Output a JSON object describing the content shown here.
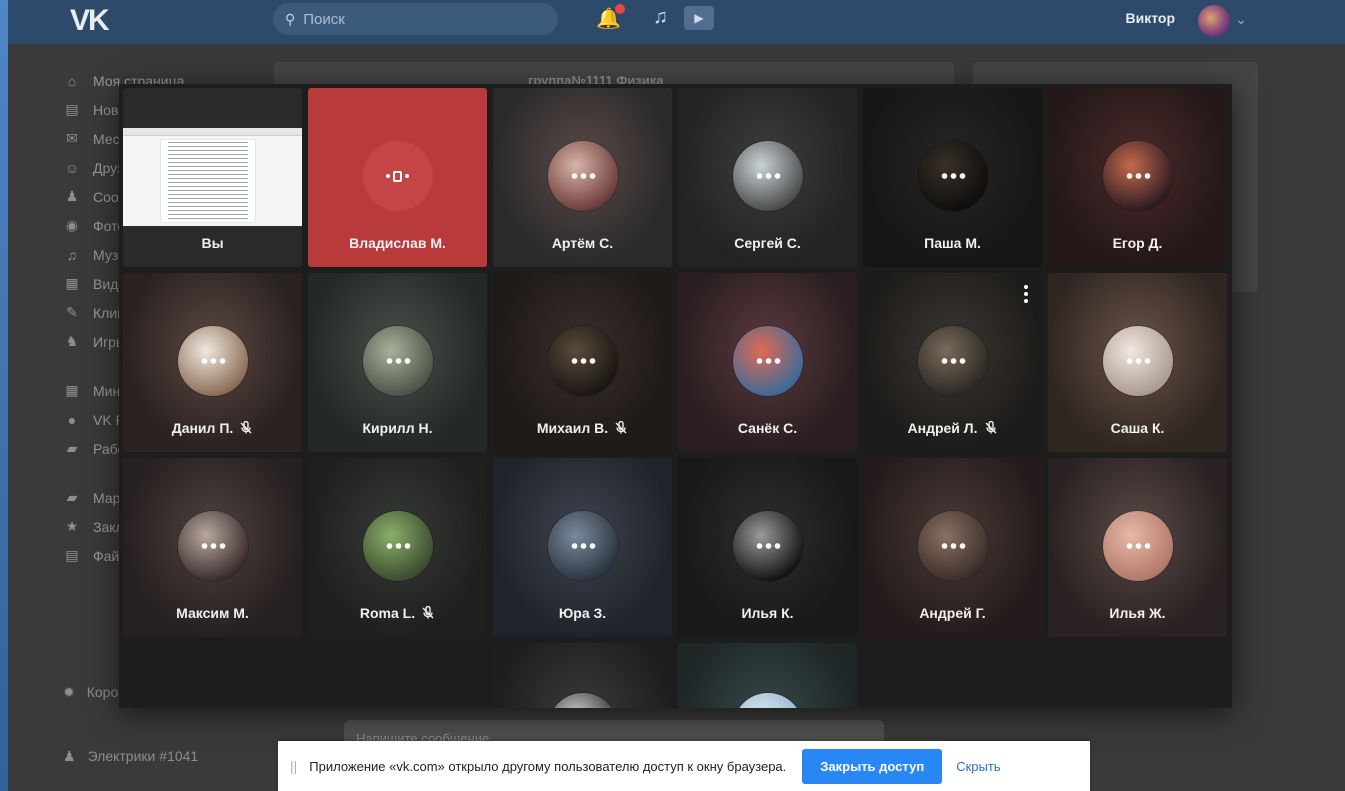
{
  "header": {
    "logo": "VK",
    "search_placeholder": "Поиск",
    "user_name": "Виктор"
  },
  "sidebar": {
    "items": [
      {
        "label": "Моя страница",
        "icon": "home-icon"
      },
      {
        "label": "Новости",
        "icon": "news-icon"
      },
      {
        "label": "Мессенджер",
        "icon": "messages-icon"
      },
      {
        "label": "Друзья",
        "icon": "friend-icon"
      },
      {
        "label": "Сообщества",
        "icon": "groups-icon"
      },
      {
        "label": "Фотографии",
        "icon": "camera-icon"
      },
      {
        "label": "Музыка",
        "icon": "music-icon"
      },
      {
        "label": "Видео",
        "icon": "video-icon"
      },
      {
        "label": "Клипы",
        "icon": "clips-icon"
      },
      {
        "label": "Игры",
        "icon": "games-icon"
      }
    ],
    "items2": [
      {
        "label": "Мини-приложения",
        "icon": "apps-icon"
      },
      {
        "label": "VK Pay",
        "icon": "pay-icon"
      },
      {
        "label": "Работа",
        "icon": "work-icon"
      }
    ],
    "items3": [
      {
        "label": "Маркет",
        "icon": "market-icon"
      },
      {
        "label": "Закладки",
        "icon": "star-icon"
      },
      {
        "label": "Файлы",
        "icon": "file-icon"
      }
    ],
    "coronavirus": "Коронавирус",
    "group_link": "Электрики #1041"
  },
  "chat": {
    "title": "группа№1111 Физика",
    "input_placeholder": "Напишите сообщение..."
  },
  "call": {
    "participants": [
      {
        "name": "Вы",
        "type": "you",
        "muted": false
      },
      {
        "name": "Владислав М.",
        "type": "red",
        "muted": false
      },
      {
        "name": "Артём С.",
        "muted": false,
        "bg": [
          "#5a4a48",
          "#2a2a2a"
        ],
        "av": [
          "#d8b4a8",
          "#6a3a38"
        ]
      },
      {
        "name": "Сергей С.",
        "muted": false,
        "bg": [
          "#3d3d3b",
          "#232323"
        ],
        "av": [
          "#c9d3d9",
          "#4a4a48"
        ]
      },
      {
        "name": "Паша М.",
        "muted": false,
        "bg": [
          "#262626",
          "#161616"
        ],
        "av": [
          "#3a3026",
          "#0e0e0e"
        ]
      },
      {
        "name": "Егор Д.",
        "muted": false,
        "bg": [
          "#4a2a2a",
          "#241818"
        ],
        "av": [
          "#c46a4a",
          "#2a1a22"
        ]
      },
      {
        "name": "Данил П.",
        "muted": true,
        "bg": [
          "#5a4842",
          "#2a2220"
        ],
        "av": [
          "#f0e8e0",
          "#8a6a54"
        ]
      },
      {
        "name": "Кирилл Н.",
        "muted": false,
        "bg": [
          "#48504a",
          "#242826"
        ],
        "av": [
          "#a8b098",
          "#4a5448"
        ]
      },
      {
        "name": "Михаил В.",
        "muted": true,
        "bg": [
          "#3a2e2a",
          "#1e1a18"
        ],
        "av": [
          "#5a4a3a",
          "#1a1614"
        ]
      },
      {
        "name": "Санёк С.",
        "muted": false,
        "bg": [
          "#5a3a3e",
          "#2a1e20"
        ],
        "av": [
          "#e06a52",
          "#3a6a9a"
        ]
      },
      {
        "name": "Андрей Л.",
        "muted": true,
        "bg": [
          "#3a3632",
          "#1e1c1a"
        ],
        "av": [
          "#7a6a58",
          "#2a2824"
        ]
      },
      {
        "name": "Саша К.",
        "muted": false,
        "bg": [
          "#6a5448",
          "#302622"
        ],
        "av": [
          "#f2e6e0",
          "#a89a92"
        ]
      },
      {
        "name": "Максим М.",
        "muted": false,
        "bg": [
          "#4e4240",
          "#262020"
        ],
        "av": [
          "#b8a8a0",
          "#3a2a2a"
        ]
      },
      {
        "name": "Roma L.",
        "muted": true,
        "bg": [
          "#363a36",
          "#1e201e"
        ],
        "av": [
          "#8ab06a",
          "#3a4a2e"
        ]
      },
      {
        "name": "Юра З.",
        "muted": false,
        "bg": [
          "#3e4450",
          "#20242a"
        ],
        "av": [
          "#7a8a9a",
          "#2a3440"
        ]
      },
      {
        "name": "Илья К.",
        "muted": false,
        "bg": [
          "#2e2e30",
          "#181818"
        ],
        "av": [
          "#9a9a9a",
          "#121212"
        ]
      },
      {
        "name": "Андрей Г.",
        "muted": false,
        "bg": [
          "#4a3a38",
          "#241c1c"
        ],
        "av": [
          "#8a7060",
          "#3a2e2a"
        ]
      },
      {
        "name": "Илья Ж.",
        "muted": false,
        "bg": [
          "#5a4a48",
          "#2a2222"
        ],
        "av": [
          "#e8b8a8",
          "#b07868"
        ]
      }
    ],
    "partial": [
      {
        "bg": [
          "#3a3a3a",
          "#1e1e1e"
        ],
        "av": [
          "#d0d0d0",
          "#2a2a2a"
        ]
      },
      {
        "bg": [
          "#38484a",
          "#1e2626"
        ],
        "av": [
          "#d8e8f0",
          "#90b0c8"
        ]
      }
    ]
  },
  "notification": {
    "text": "Приложение «vk.com» открыло другому пользователю доступ к окну браузера.",
    "close_label": "Закрыть доступ",
    "hide_label": "Скрыть"
  }
}
